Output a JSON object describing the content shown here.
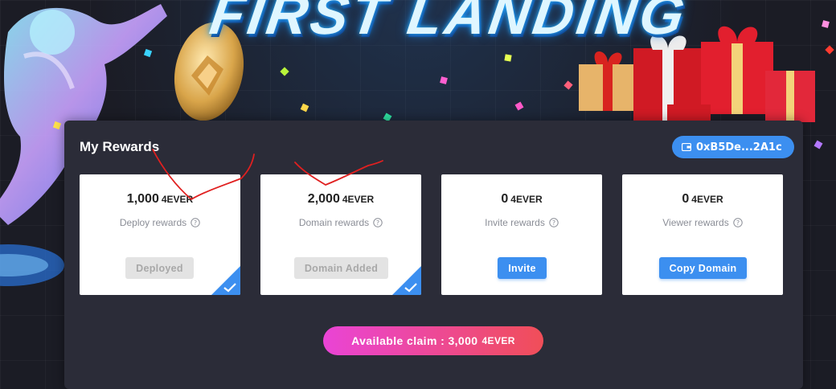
{
  "banner": {
    "title": "FIRST LANDING"
  },
  "rewards": {
    "title": "My Rewards",
    "wallet": "0xB5De...2A1c",
    "unit": "4EVER",
    "cards": [
      {
        "amount": "1,000",
        "label": "Deploy rewards",
        "button": "Deployed",
        "state": "completed"
      },
      {
        "amount": "2,000",
        "label": "Domain rewards",
        "button": "Domain Added",
        "state": "completed"
      },
      {
        "amount": "0",
        "label": "Invite rewards",
        "button": "Invite",
        "state": "active"
      },
      {
        "amount": "0",
        "label": "Viewer rewards",
        "button": "Copy Domain",
        "state": "active"
      }
    ],
    "claim": {
      "text": "Available claim : 3,000",
      "unit": "4EVER"
    }
  },
  "colors": {
    "accent": "#3c8ff0",
    "claim_from": "#ea44d6",
    "claim_to": "#f04e58",
    "annotation": "#e02020"
  }
}
